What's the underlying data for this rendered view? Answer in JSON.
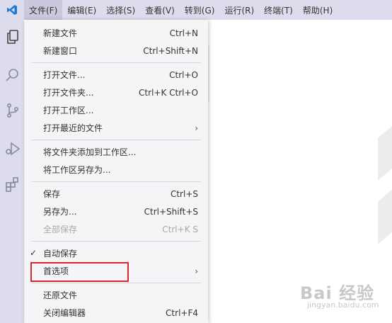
{
  "menubar": {
    "items": [
      {
        "label": "文件(F)"
      },
      {
        "label": "编辑(E)"
      },
      {
        "label": "选择(S)"
      },
      {
        "label": "查看(V)"
      },
      {
        "label": "转到(G)"
      },
      {
        "label": "运行(R)"
      },
      {
        "label": "终端(T)"
      },
      {
        "label": "帮助(H)"
      }
    ]
  },
  "file_menu": {
    "new_file": {
      "label": "新建文件",
      "shortcut": "Ctrl+N"
    },
    "new_window": {
      "label": "新建窗口",
      "shortcut": "Ctrl+Shift+N"
    },
    "open_file": {
      "label": "打开文件...",
      "shortcut": "Ctrl+O"
    },
    "open_folder": {
      "label": "打开文件夹...",
      "shortcut": "Ctrl+K Ctrl+O"
    },
    "open_workspace": {
      "label": "打开工作区..."
    },
    "open_recent": {
      "label": "打开最近的文件",
      "arrow": "›"
    },
    "add_folder": {
      "label": "将文件夹添加到工作区..."
    },
    "save_workspace_as": {
      "label": "将工作区另存为..."
    },
    "save": {
      "label": "保存",
      "shortcut": "Ctrl+S"
    },
    "save_as": {
      "label": "另存为...",
      "shortcut": "Ctrl+Shift+S"
    },
    "save_all": {
      "label": "全部保存",
      "shortcut": "Ctrl+K S"
    },
    "auto_save": {
      "label": "自动保存",
      "check": "✓"
    },
    "preferences": {
      "label": "首选项",
      "arrow": "›"
    },
    "revert_file": {
      "label": "还原文件"
    },
    "close_editor": {
      "label": "关闭编辑器",
      "shortcut": "Ctrl+F4"
    }
  },
  "watermark": {
    "main": "Bai 经验",
    "sub": "jingyan.baidu.com"
  },
  "colors": {
    "menubar_bg": "#dddcec",
    "highlight_border": "#e0262d",
    "vscode_blue": "#1f7ad4"
  }
}
